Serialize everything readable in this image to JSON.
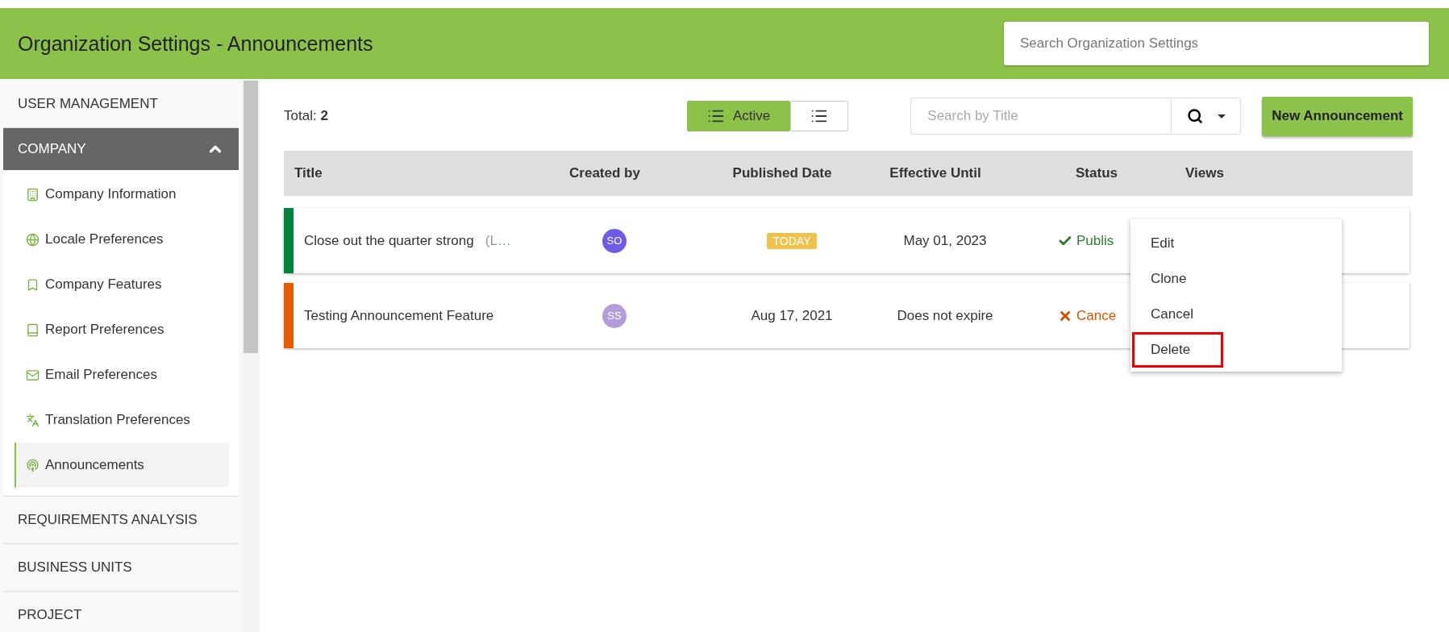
{
  "header": {
    "title": "Organization Settings - Announcements",
    "search": {
      "placeholder": "Search Organization Settings"
    }
  },
  "sidebar": {
    "sections": [
      {
        "label": "USER MANAGEMENT",
        "expanded": false
      },
      {
        "label": "COMPANY",
        "expanded": true,
        "children": [
          {
            "label": "Company Information",
            "selected": false
          },
          {
            "label": "Locale Preferences",
            "selected": false
          },
          {
            "label": "Company Features",
            "selected": false
          },
          {
            "label": "Report Preferences",
            "selected": false
          },
          {
            "label": "Email Preferences",
            "selected": false
          },
          {
            "label": "Translation Preferences",
            "selected": false
          },
          {
            "label": "Announcements",
            "selected": true
          }
        ]
      },
      {
        "label": "REQUIREMENTS ANALYSIS",
        "expanded": false
      },
      {
        "label": "BUSINESS UNITS",
        "expanded": false
      },
      {
        "label": "PROJECT",
        "expanded": false
      }
    ]
  },
  "toolbar": {
    "total_label": "Total:",
    "total": "2",
    "views": [
      {
        "label": "Active",
        "selected": true
      },
      {
        "selected": false
      }
    ],
    "search": {
      "placeholder": "Search by Title"
    },
    "new_button": "New Announcement"
  },
  "table": {
    "columns": [
      "Title",
      "Created by",
      "Published Date",
      "Effective Until",
      "Status",
      "Views"
    ],
    "rows": [
      {
        "title": "Close out the quarter strong",
        "note": "(L…",
        "color": "#00843d",
        "creator": {
          "initials": "SO",
          "color": "#6c5ce7"
        },
        "published": {
          "kind": "badge",
          "text": "TODAY"
        },
        "effective": "May 01, 2023",
        "status": {
          "kind": "published",
          "text": "Publis"
        }
      },
      {
        "title": "Testing Announcement Feature",
        "color": "#e65c00",
        "creator": {
          "initials": "SS",
          "color": "#b39ddb"
        },
        "published": {
          "kind": "text",
          "text": "Aug 17, 2021"
        },
        "effective": "Does not expire",
        "status": {
          "kind": "cancelled",
          "text": "Cance"
        }
      }
    ]
  },
  "menu": {
    "items": [
      {
        "label": "Edit",
        "highlighted": false
      },
      {
        "label": "Clone",
        "highlighted": false
      },
      {
        "label": "Cancel",
        "highlighted": false
      },
      {
        "label": "Delete",
        "highlighted": true
      }
    ]
  }
}
